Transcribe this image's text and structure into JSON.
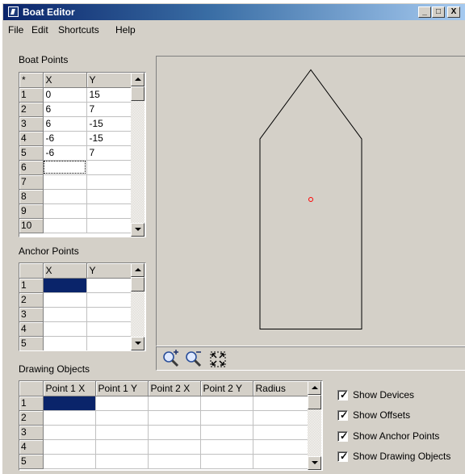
{
  "window": {
    "title": "Boat Editor",
    "minimize": "_",
    "maximize": "□",
    "close": "X"
  },
  "menu": [
    "File",
    "Edit",
    "Shortcuts",
    "Help"
  ],
  "boat_points": {
    "label": "Boat Points",
    "corner": "*",
    "headers": [
      "X",
      "Y"
    ],
    "rows": [
      {
        "n": "1",
        "x": "0",
        "y": "15"
      },
      {
        "n": "2",
        "x": "6",
        "y": "7"
      },
      {
        "n": "3",
        "x": "6",
        "y": "-15"
      },
      {
        "n": "4",
        "x": "-6",
        "y": "-15"
      },
      {
        "n": "5",
        "x": "-6",
        "y": "7"
      },
      {
        "n": "6",
        "x": "",
        "y": ""
      },
      {
        "n": "7",
        "x": "",
        "y": ""
      },
      {
        "n": "8",
        "x": "",
        "y": ""
      },
      {
        "n": "9",
        "x": "",
        "y": ""
      },
      {
        "n": "10",
        "x": "",
        "y": ""
      }
    ]
  },
  "anchor_points": {
    "label": "Anchor Points",
    "headers": [
      "X",
      "Y"
    ],
    "rows": [
      "1",
      "2",
      "3",
      "4",
      "5"
    ]
  },
  "drawing_objects": {
    "label": "Drawing Objects",
    "headers": [
      "Point 1 X",
      "Point 1 Y",
      "Point 2 X",
      "Point 2 Y",
      "Radius"
    ],
    "rows": [
      "1",
      "2",
      "3",
      "4",
      "5"
    ]
  },
  "options": {
    "show_devices": {
      "label": "Show Devices",
      "checked": true
    },
    "show_offsets": {
      "label": "Show Offsets",
      "checked": true
    },
    "show_anchor_points": {
      "label": "Show Anchor Points",
      "checked": true
    },
    "show_drawing_objects": {
      "label": "Show Drawing Objects",
      "checked": true
    }
  },
  "colors": {
    "hull_outline": "#000000",
    "origin_marker": "#ff0000",
    "selection": "#0a246a"
  },
  "icons": [
    "zoom-in-icon",
    "zoom-out-icon",
    "zoom-fit-icon"
  ]
}
